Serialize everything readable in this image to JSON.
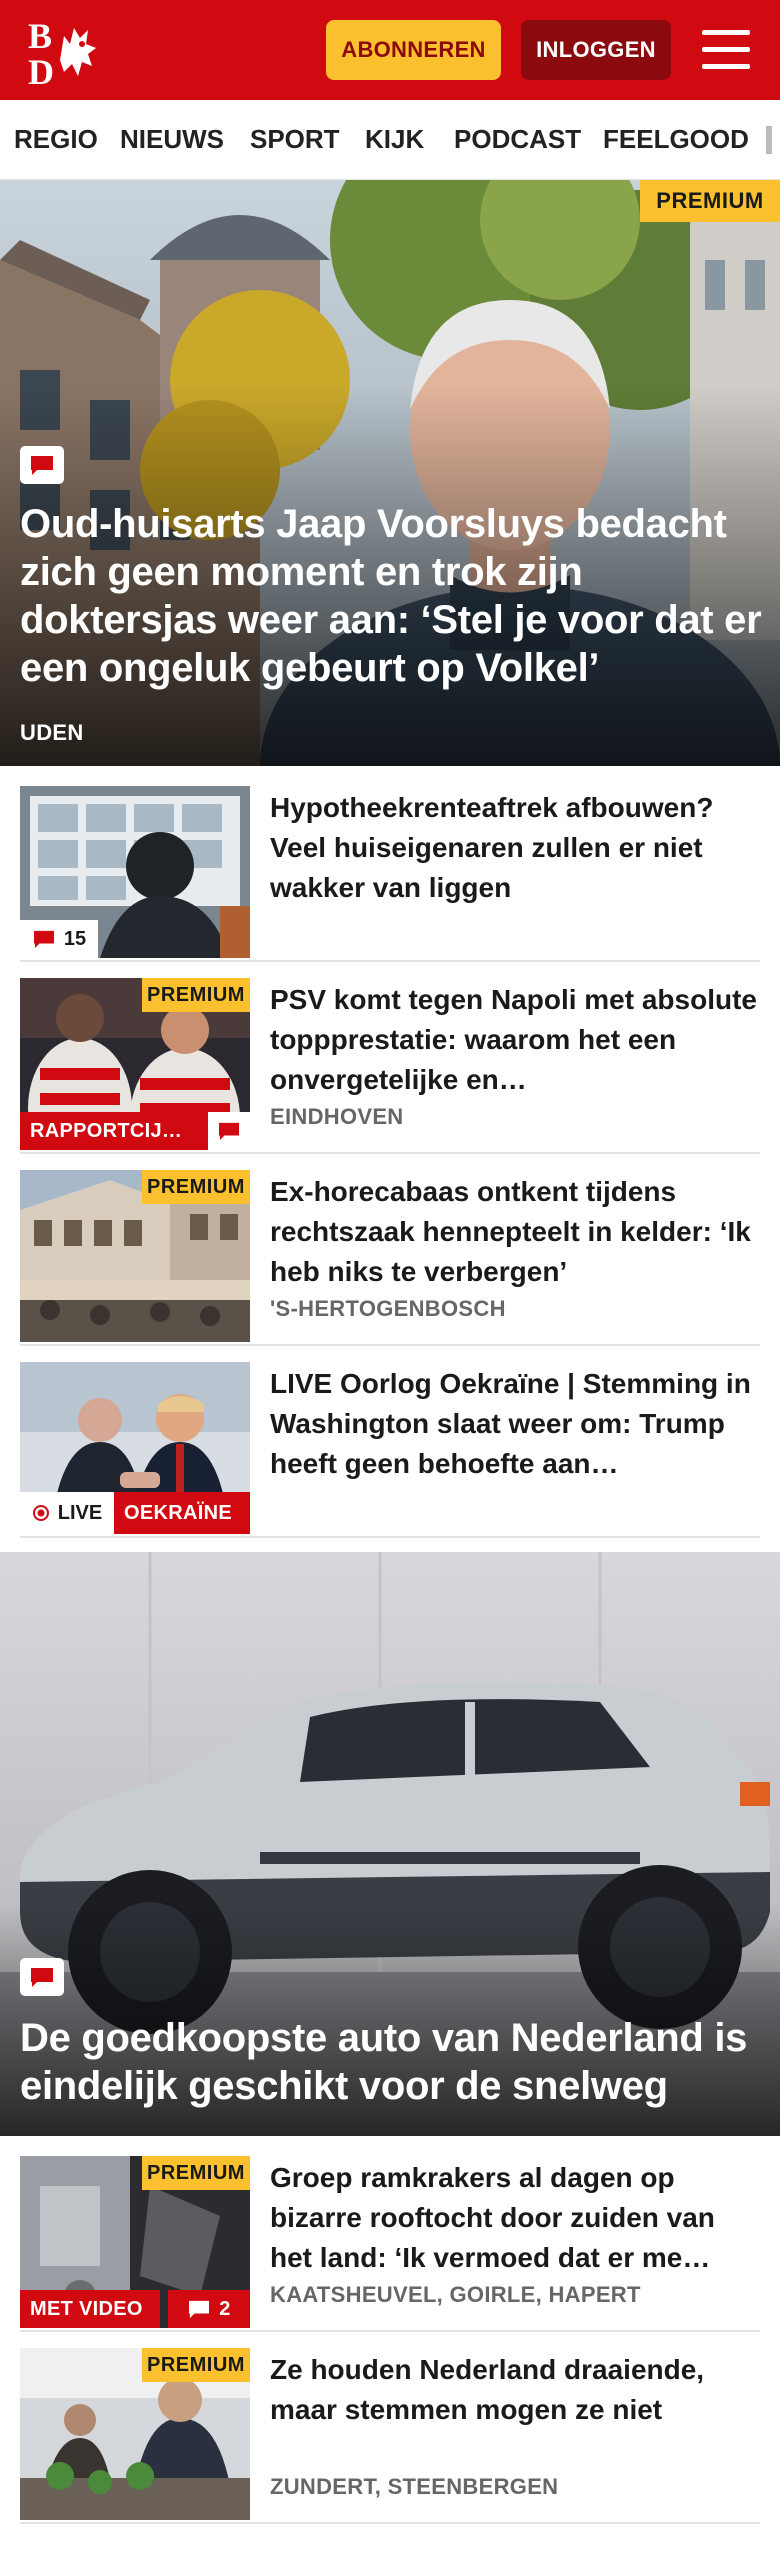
{
  "header": {
    "logo_text": "BD",
    "subscribe_label": "ABONNEREN",
    "login_label": "INLOGGEN",
    "brand_color": "#d10a11"
  },
  "nav": {
    "items": [
      "REGIO",
      "NIEUWS",
      "SPORT",
      "KIJK",
      "PODCAST",
      "FEELGOOD"
    ]
  },
  "hero": {
    "badge": "PREMIUM",
    "title": "Oud-huisarts Jaap Voorsluys bedacht zich geen moment en trok zijn doktersjas weer aan: ‘Stel je voor dat er een ongeluk gebeurt op Volkel’",
    "location": "UDEN",
    "icon": "comment-icon"
  },
  "articles": [
    {
      "title": "Hypotheekrenteaftrek afbouwen? Veel huiseigenaren zullen er niet wakker van liggen",
      "location": "",
      "comments": "15"
    },
    {
      "badge": "PREMIUM",
      "title": "PSV komt tegen Napoli met absolute toppprestatie: waarom het een onvergetelijke en…",
      "location": "EINDHOVEN",
      "label": "RAPPORTCIJ…"
    },
    {
      "badge": "PREMIUM",
      "title": "Ex-horecabaas ontkent tijdens rechtszaak hennepteelt in kelder: ‘Ik heb niks te verbergen’",
      "location": "'S-HERTOGENBOSCH"
    },
    {
      "title": "LIVE Oorlog Oekraïne | Stemming in Washington slaat weer om: Trump heeft geen behoefte aan…",
      "live_label": "LIVE",
      "label": "OEKRAÏNE"
    }
  ],
  "hero2": {
    "title": "De goedkoopste auto van Nederland is eindelijk geschikt voor de snelweg",
    "icon": "comment-icon"
  },
  "articles2": [
    {
      "badge": "PREMIUM",
      "title": "Groep ramkrakers al dagen op bizarre rooftocht door zuiden van het land: ‘Ik vermoed dat er me…",
      "location": "KAATSHEUVEL, GOIRLE, HAPERT",
      "label": "MET VIDEO",
      "comments": "2"
    },
    {
      "badge": "PREMIUM",
      "title": "Ze houden Nederland draaiende, maar stemmen mogen ze niet",
      "location": "ZUNDERT, STEENBERGEN"
    }
  ]
}
